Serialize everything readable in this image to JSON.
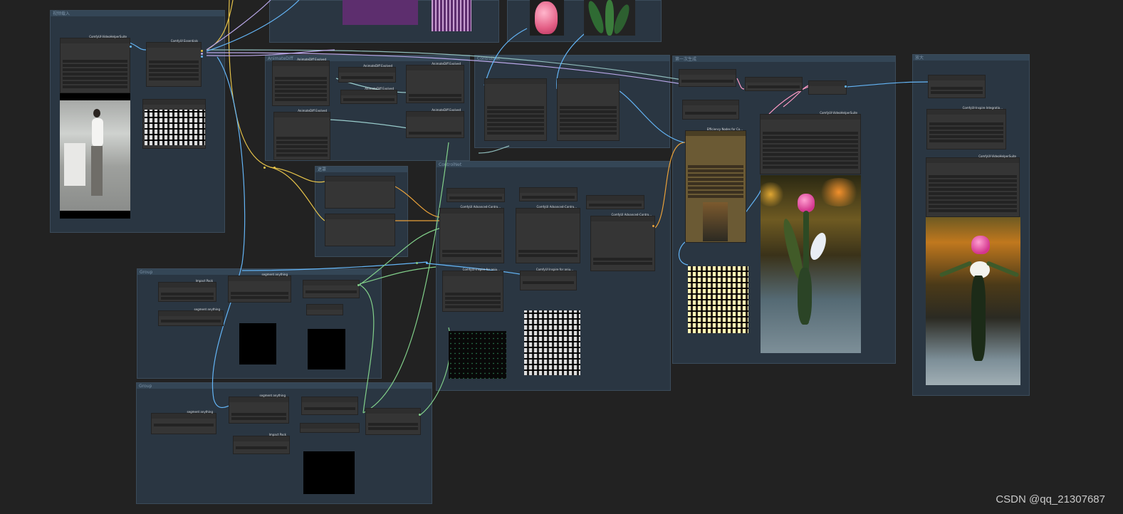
{
  "groups": [
    {
      "title": "视频载入",
      "color": "#2b3743"
    },
    {
      "title": "AnimateDiff",
      "color": "#2b3743"
    },
    {
      "title": "ControlNet",
      "color": "#2b3743"
    },
    {
      "title": "第一次生成",
      "color": "#2b3743"
    },
    {
      "title": "放大",
      "color": "#2b3743"
    },
    {
      "title": "遮罩",
      "color": "#2b3743"
    },
    {
      "title": "Group",
      "color": "#2b3743"
    },
    {
      "title": "Group",
      "color": "#2b3743"
    }
  ],
  "nodes": {
    "load_video": "ComfyUI-VideoHelperSuite",
    "upscale": "ComfyUI Essentials",
    "ad_1": "AnimateDiff Evolved",
    "ad_2": "AnimateDiff Evolved",
    "ad_3": "AnimateDiff Evolved",
    "ad_4": "AnimateDiff Evolved",
    "ad_5": "AnimateDiff Evolved",
    "cn_1": "ComfyUI Advanced-Contro...",
    "cn_2": "ComfyUI Advanced-Contro...",
    "cn_3": "ComfyUI Advanced-Contro...",
    "cn_pre_1": "ComfyUI-Inspire for aniu...",
    "cn_pre_2": "ComfyUI Inspire for aniu...",
    "ksampler": "Efficiency Nodes for Co...",
    "vhs_combine_1": "ComfyUI-VideoHelperSuite",
    "upscale_img": "ComfyUI-Inspire Integratio...",
    "vhs_combine_2": "ComfyUI-VideoHelperSuite",
    "seg_1": "segment anything",
    "seg_2": "segment anything",
    "seg_3": "segment anything",
    "impact_1": "Impact Pack",
    "impact_2": "Impact Pack",
    "impact_3": "segment anything"
  },
  "watermark": "CSDN @qq_21307687",
  "colors": {
    "clip": "#e6c34a",
    "model": "#b9a7e8",
    "image": "#64b5f6",
    "cond": "#e9a13a",
    "latent": "#ff9bc5",
    "mask": "#82d08a"
  }
}
